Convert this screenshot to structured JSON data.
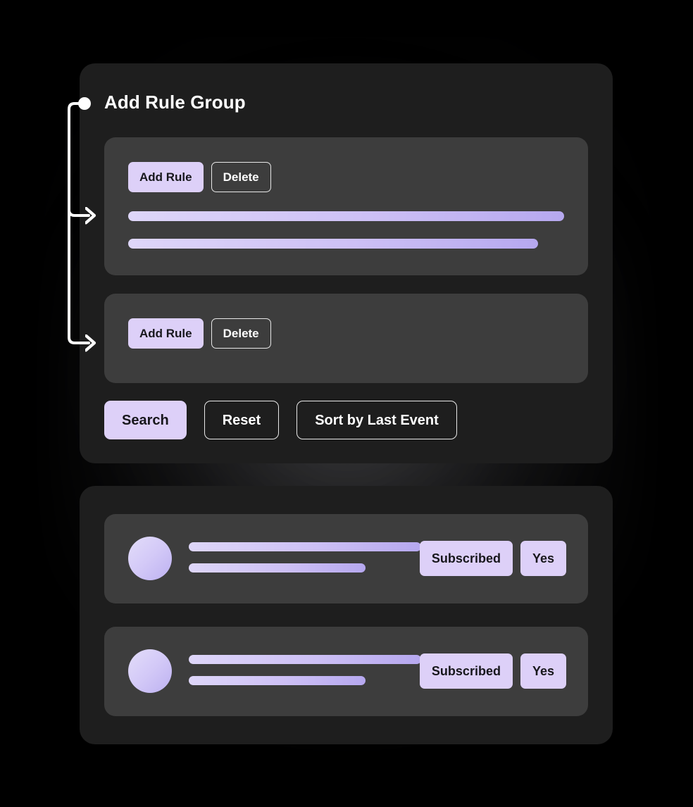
{
  "theme": {
    "page_background": "#000000",
    "card_background": "#1e1e1e",
    "panel_background": "#3d3d3d",
    "accent_lavender": "#ddd0f8",
    "skeleton_gradient_start": "#ded6f9",
    "skeleton_gradient_end": "#b6a8ef",
    "text_on_accent": "#17171c",
    "text_primary": "#ffffff",
    "connector_color": "#ffffff"
  },
  "connector": {
    "name": "add-rule-group-connector",
    "dot_label": "",
    "branch_count": 2
  },
  "rules_card": {
    "title": "Add Rule Group",
    "groups": [
      {
        "add_rule_label": "Add Rule",
        "delete_label": "Delete",
        "skeleton_bars": 2
      },
      {
        "add_rule_label": "Add Rule",
        "delete_label": "Delete",
        "skeleton_bars": 0
      }
    ],
    "footer_actions": [
      {
        "label": "Search",
        "style": "primary"
      },
      {
        "label": "Reset",
        "style": "outline"
      },
      {
        "label": "Sort by Last Event",
        "style": "outline"
      }
    ]
  },
  "results_card": {
    "rows": [
      {
        "avatar": "avatar-placeholder",
        "badges": [
          {
            "label": "Subscribed"
          },
          {
            "label": "Yes"
          }
        ]
      },
      {
        "avatar": "avatar-placeholder",
        "badges": [
          {
            "label": "Subscribed"
          },
          {
            "label": "Yes"
          }
        ]
      }
    ]
  }
}
